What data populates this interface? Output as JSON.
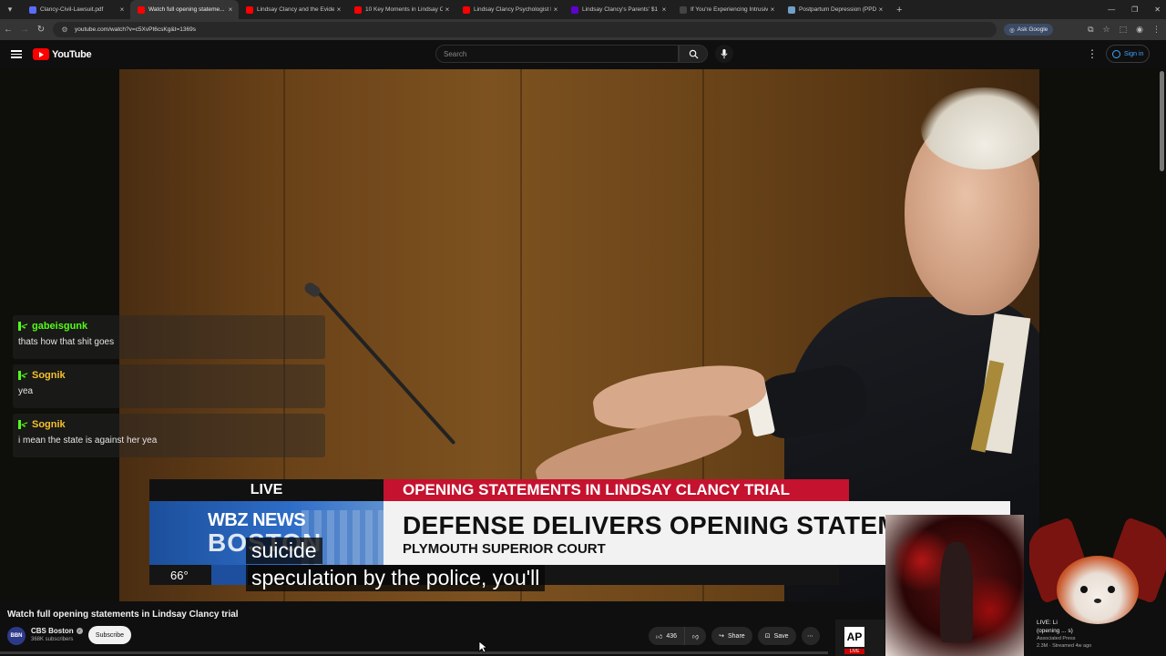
{
  "browser": {
    "tabs": [
      {
        "title": "Clancy-Civil-Lawsuit.pdf",
        "favicon": "pdf-icon",
        "color": "#5a6bff",
        "active": false
      },
      {
        "title": "Watch full opening stateme...",
        "favicon": "youtube-icon",
        "color": "#ff0000",
        "active": true
      },
      {
        "title": "Lindsay Clancy and the Evidenc...",
        "favicon": "youtube-icon",
        "color": "#ff0000",
        "active": false
      },
      {
        "title": "10 Key Moments in Lindsay Cl...",
        "favicon": "youtube-icon",
        "color": "#ff0000",
        "active": false
      },
      {
        "title": "Lindsay Clancy Psychologist Di...",
        "favicon": "youtube-icon",
        "color": "#ff0000",
        "active": false
      },
      {
        "title": "Lindsay Clancy's Parents' $1 Mi...",
        "favicon": "yahoo-icon",
        "color": "#6001d2",
        "active": false
      },
      {
        "title": "If You're Experiencing Intrusive...",
        "favicon": "site-icon",
        "color": "#444444",
        "active": false
      },
      {
        "title": "Postpartum Depression (PPD) ...",
        "favicon": "site-icon",
        "color": "#6ea0c8",
        "active": false
      }
    ],
    "url": "youtube.com/watch?v=c5XvPt6csKg&t=1369s",
    "ask_google": "Ask Google"
  },
  "youtube": {
    "logo_text": "YouTube",
    "search_placeholder": "Search",
    "sign_in": "Sign in"
  },
  "chat": [
    {
      "user": "gabeisgunk",
      "user_color": "#53fc18",
      "text": "thats how that shit goes"
    },
    {
      "user": "Sognik",
      "user_color": "#f3c12c",
      "text": "yea"
    },
    {
      "user": "Sognik",
      "user_color": "#f3c12c",
      "text": "i mean the state is against her yea"
    }
  ],
  "broadcast": {
    "live_label": "LIVE",
    "top_headline": "OPENING STATEMENTS IN LINDSAY CLANCY TRIAL",
    "station_line1": "WBZ NEWS",
    "station_line2": "BOSTON",
    "main_headline": "DEFENSE DELIVERS OPENING STATEMENT",
    "sub_headline": "PLYMOUTH SUPERIOR COURT",
    "temperature": "66°"
  },
  "captions": [
    "suicide",
    "speculation by the police, you'll"
  ],
  "video": {
    "title": "Watch full opening statements in Lindsay Clancy trial",
    "channel": "CBS Boston",
    "channel_avatar_text": "BBN",
    "subscribers": "368K subscribers",
    "subscribe_label": "Subscribe",
    "likes": "436",
    "share_label": "Share",
    "save_label": "Save"
  },
  "recommendation": {
    "title_line1": "LIVE: Li",
    "title_line2": "(opening ... s)",
    "channel": "Associated Press",
    "meta": "2.3M · Streamed 4w ago",
    "thumb_logo": "AP",
    "thumb_badge": "LIVE"
  }
}
